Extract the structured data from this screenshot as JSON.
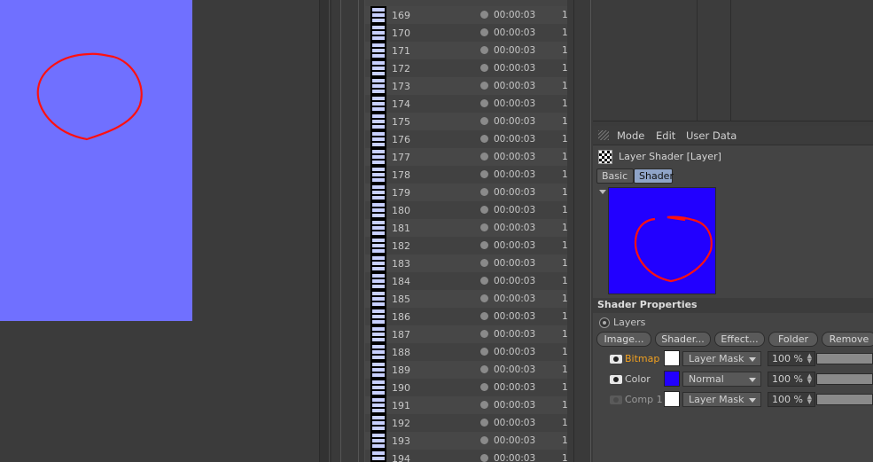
{
  "list": {
    "rows": [
      {
        "num": "169",
        "time": "00:00:03",
        "extra": "1"
      },
      {
        "num": "170",
        "time": "00:00:03",
        "extra": "1"
      },
      {
        "num": "171",
        "time": "00:00:03",
        "extra": "1"
      },
      {
        "num": "172",
        "time": "00:00:03",
        "extra": "1"
      },
      {
        "num": "173",
        "time": "00:00:03",
        "extra": "1"
      },
      {
        "num": "174",
        "time": "00:00:03",
        "extra": "1"
      },
      {
        "num": "175",
        "time": "00:00:03",
        "extra": "1"
      },
      {
        "num": "176",
        "time": "00:00:03",
        "extra": "1"
      },
      {
        "num": "177",
        "time": "00:00:03",
        "extra": "1"
      },
      {
        "num": "178",
        "time": "00:00:03",
        "extra": "1"
      },
      {
        "num": "179",
        "time": "00:00:03",
        "extra": "1"
      },
      {
        "num": "180",
        "time": "00:00:03",
        "extra": "1"
      },
      {
        "num": "181",
        "time": "00:00:03",
        "extra": "1"
      },
      {
        "num": "182",
        "time": "00:00:03",
        "extra": "1"
      },
      {
        "num": "183",
        "time": "00:00:03",
        "extra": "1"
      },
      {
        "num": "184",
        "time": "00:00:03",
        "extra": "1"
      },
      {
        "num": "185",
        "time": "00:00:03",
        "extra": "1"
      },
      {
        "num": "186",
        "time": "00:00:03",
        "extra": "1"
      },
      {
        "num": "187",
        "time": "00:00:03",
        "extra": "1"
      },
      {
        "num": "188",
        "time": "00:00:03",
        "extra": "1"
      },
      {
        "num": "189",
        "time": "00:00:03",
        "extra": "1"
      },
      {
        "num": "190",
        "time": "00:00:03",
        "extra": "1"
      },
      {
        "num": "191",
        "time": "00:00:03",
        "extra": "1"
      },
      {
        "num": "192",
        "time": "00:00:03",
        "extra": "1"
      },
      {
        "num": "193",
        "time": "00:00:03",
        "extra": "1"
      },
      {
        "num": "194",
        "time": "00:00:03",
        "extra": "1"
      }
    ]
  },
  "attr": {
    "menu": {
      "mode": "Mode",
      "edit": "Edit",
      "user_data": "User Data"
    },
    "object_title": "Layer Shader [Layer]",
    "tabs": {
      "basic": "Basic",
      "shader": "Shader"
    },
    "section_title": "Shader Properties",
    "layers_label": "Layers",
    "buttons": {
      "image": "Image...",
      "shader": "Shader...",
      "effect": "Effect...",
      "folder": "Folder",
      "remove": "Remove"
    },
    "layers": [
      {
        "name": "Bitmap",
        "name_color": "#f0a020",
        "swatch": "#ffffff",
        "mode": "Layer Mask",
        "percent": "100 %",
        "visible": true
      },
      {
        "name": "Color",
        "name_color": "#d0d0d0",
        "swatch": "#2200ff",
        "mode": "Normal",
        "percent": "100 %",
        "visible": true
      },
      {
        "name": "Comp 1",
        "name_color": "#9a9a9a",
        "swatch": "#ffffff",
        "mode": "Layer Mask",
        "percent": "100 %",
        "visible": false
      }
    ]
  },
  "colors": {
    "viewport_bg": "#7070ff",
    "preview_bg": "#2200ff",
    "stroke": "#ff1010",
    "active_tab": "#8fa4c8"
  }
}
